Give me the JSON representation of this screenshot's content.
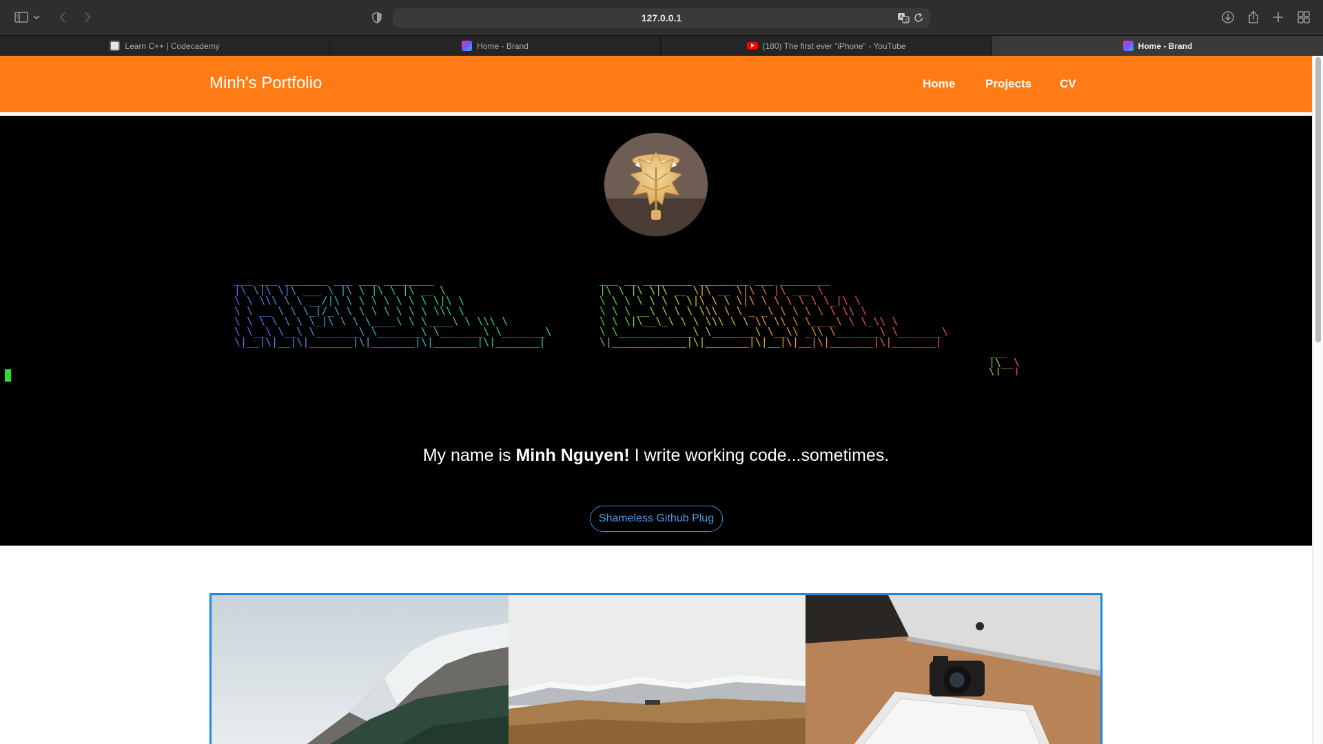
{
  "browser": {
    "url": "127.0.0.1",
    "icons": {
      "sidebar": "sidebar-icon",
      "tab_group_menu": "chevron-down-icon",
      "back": "back-arrow-icon",
      "forward": "forward-arrow-icon",
      "privacy": "shield-icon",
      "translate": "translate-icon",
      "reload": "reload-icon",
      "downloads": "download-icon",
      "share": "share-icon",
      "new_tab": "plus-icon",
      "tab_overview": "grid-icon"
    },
    "tabs": [
      {
        "title": "Learn C++ | Codecademy",
        "favicon": "codecademy-icon",
        "active": false
      },
      {
        "title": "Home - Brand",
        "favicon": "brand-icon",
        "active": false
      },
      {
        "title": "(180) The first ever \"iPhone\" - YouTube",
        "favicon": "youtube-icon",
        "active": false
      },
      {
        "title": "Home - Brand",
        "favicon": "brand-icon",
        "active": true
      }
    ]
  },
  "site": {
    "brand": "Minh's Portfolio",
    "nav": [
      "Home",
      "Projects",
      "CV"
    ],
    "hero": {
      "avatar": "profile-photo-maple-cookie",
      "banner": "ascii-art-hello-world",
      "intro_prefix": "My name is ",
      "intro_name": "Minh Nguyen!",
      "intro_suffix": " I write working code...sometimes.",
      "button": "Shameless Github Plug"
    },
    "gallery": [
      "mountain-photo",
      "hills-landscape-photo",
      "desk-camera-keyboard-photo"
    ]
  },
  "colors": {
    "nav_bg": "#ff7b16",
    "hero_bg": "#000000",
    "button_accent": "#3f8fd6",
    "gallery_border": "#1e88e5",
    "rainbow_hello": [
      "#5b6cf0",
      "#3fa7e0",
      "#33c7a5",
      "#3fd47a"
    ],
    "rainbow_world": [
      "#3fd44a",
      "#a9d83c",
      "#f0b23a",
      "#f0703c",
      "#ec3f8e"
    ],
    "cursor": "#27e032"
  }
}
